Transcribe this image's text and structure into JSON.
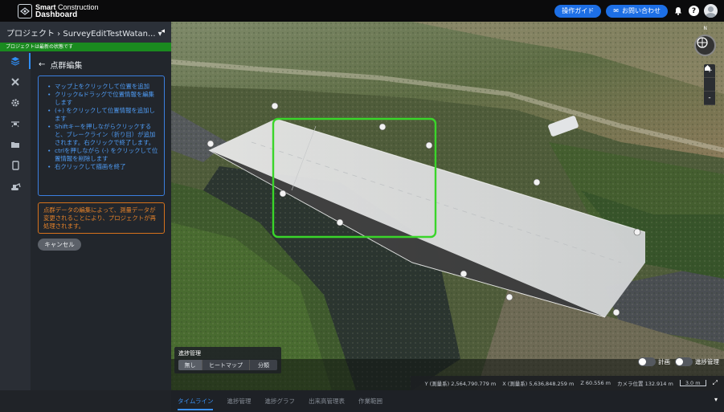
{
  "header": {
    "brand_line1_bold": "Smart",
    "brand_line1_rest": " Construction",
    "brand_line2": "Dashboard",
    "guide_button": "操作ガイド",
    "contact_button": "お問い合わせ",
    "mail_icon": "✉",
    "bell_icon": "🔔",
    "help_icon": "?"
  },
  "project": {
    "breadcrumb": "プロジェクト › SurveyEditTestWatan... ▾",
    "collapse_icon": "◂",
    "status": "プロジェクトは最新の状態です"
  },
  "rail": {
    "items": [
      "layers-icon",
      "tools-icon",
      "gear-icon",
      "drone-icon",
      "folder-icon",
      "tablet-icon",
      "excavator-icon"
    ]
  },
  "panel": {
    "back_icon": "←",
    "title": "点群編集",
    "instructions": [
      "マップ上をクリックして位置を追加",
      "クリック&ドラッグで位置情報を編集します",
      "(+) をクリックして位置情報を追加します",
      "Shiftキーを押しながらクリックすると、ブレークライン（折り目）が追加されます。右クリックで終了します。",
      "ctrlを押しながら (-) をクリックして位置情報を削除します",
      "右クリックして描画を終了"
    ],
    "warning": "点群データの編集によって、測量データが変更されることにより、プロジェクトが再処理されます。",
    "cancel_label": "キャンセル"
  },
  "map": {
    "compass_label": "N",
    "zoom_in": "+",
    "home_icon": "⌂",
    "zoom_out": "-",
    "progress": {
      "title": "進捗管理",
      "options": [
        "無し",
        "ヒートマップ",
        "分類"
      ],
      "selected": "無し"
    },
    "toggles": {
      "plan": "計画",
      "progress": "進捗管理"
    },
    "coords": {
      "y": "Y (測量系) 2,564,790.779 m",
      "x": "X (測量系) 5,636,848.259 m",
      "z": "Z 60.556 m",
      "camera": "カメラ位置 132.914 m",
      "scale": "3.0 m",
      "fullscreen_icon": "⤢"
    }
  },
  "tabs": {
    "items": [
      "タイムライン",
      "進捗管理",
      "進捗グラフ",
      "出来高管理表",
      "作業範囲"
    ],
    "active": "タイムライン",
    "caret": "▾"
  },
  "colors": {
    "accent": "#1d6fe5",
    "status_green": "#1a8a1f",
    "info_blue": "#4f9cf5",
    "warning_orange": "#e1802a",
    "selection_green": "#3ad52a"
  }
}
